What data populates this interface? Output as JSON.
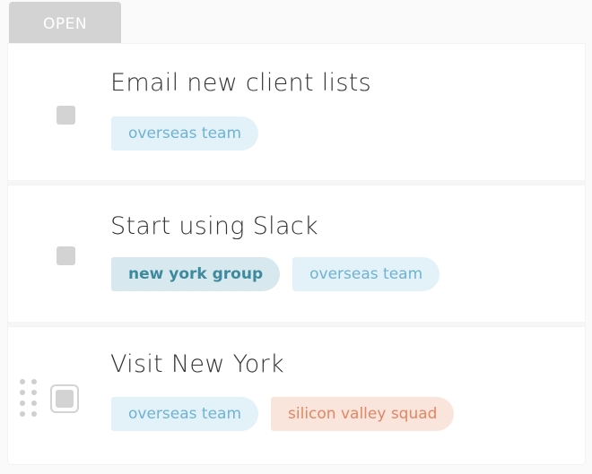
{
  "section": {
    "label": "OPEN"
  },
  "tasks": [
    {
      "title": "Email new client lists",
      "tags": [
        {
          "label": "overseas team"
        }
      ]
    },
    {
      "title": "Start using Slack",
      "tags": [
        {
          "label": "new york group"
        },
        {
          "label": "overseas team"
        }
      ]
    },
    {
      "title": "Visit New York",
      "tags": [
        {
          "label": "overseas team"
        },
        {
          "label": "silicon valley squad"
        }
      ]
    }
  ],
  "colors": {
    "overseas_team_bg": "#e3f1f8",
    "overseas_team_text": "#6fb3d3",
    "new_york_group_bg": "#d8e8ef",
    "new_york_group_text": "#3d8a9e",
    "silicon_valley_squad_bg": "#fae5dd",
    "silicon_valley_squad_text": "#e08763"
  }
}
